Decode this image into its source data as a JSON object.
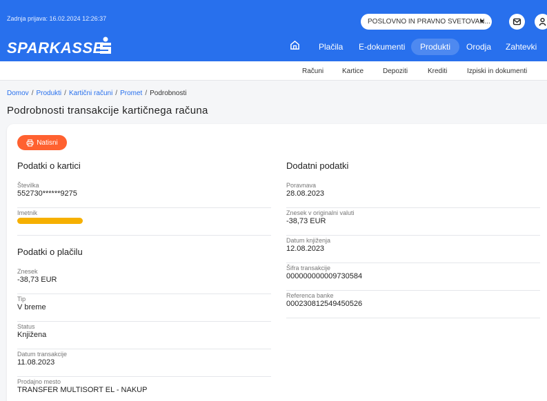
{
  "header": {
    "last_login": "Zadnja prijava: 16.02.2024 12:26:37",
    "company_select": "POSLOVNO IN PRAVNO SVETOVAN...",
    "logo_text": "SPARKASSE",
    "brand_color": "#2870ed",
    "accent_color": "#ff6130",
    "icons": [
      "home-icon",
      "mail-icon",
      "user-icon",
      "chevron-down-icon"
    ],
    "nav": {
      "placila": "Plačila",
      "edokumenti": "E-dokumenti",
      "produkti": "Produkti",
      "orodja": "Orodja",
      "zahtevki": "Zahtevki"
    }
  },
  "subnav": {
    "racuni": "Računi",
    "kartice": "Kartice",
    "depoziti": "Depoziti",
    "krediti": "Krediti",
    "izpiski": "Izpiski in dokumenti"
  },
  "breadcrumb": {
    "domov": "Domov",
    "produkti": "Produkti",
    "karticni_racuni": "Kartični računi",
    "promet": "Promet",
    "current": "Podrobnosti",
    "sep": "/"
  },
  "page_title": "Podrobnosti transakcije kartičnega računa",
  "print_button": "Natisni",
  "card_info": {
    "title": "Podatki o kartici",
    "stevilka_label": "Številka",
    "stevilka_value": "552730******9275",
    "imetnik_label": "Imetnik"
  },
  "payment_info": {
    "title": "Podatki o plačilu",
    "znesek_label": "Znesek",
    "znesek_value": "-38,73 EUR",
    "tip_label": "Tip",
    "tip_value": "V breme",
    "status_label": "Status",
    "status_value": "Knjižena",
    "datum_label": "Datum transakcije",
    "datum_value": "11.08.2023",
    "prodajno_label": "Prodajno mesto",
    "prodajno_value": "TRANSFER MULTISORT EL - NAKUP"
  },
  "extra_info": {
    "title": "Dodatni podatki",
    "poravnava_label": "Poravnava",
    "poravnava_value": "28.08.2023",
    "znesek_orig_label": "Znesek v originalni valuti",
    "znesek_orig_value": "-38,73 EUR",
    "datum_knj_label": "Datum knjiženja",
    "datum_knj_value": "12.08.2023",
    "sifra_label": "Šifra transakcije",
    "sifra_value": "000000000009730584",
    "referenca_label": "Referenca banke",
    "referenca_value": "000230812549450526"
  }
}
